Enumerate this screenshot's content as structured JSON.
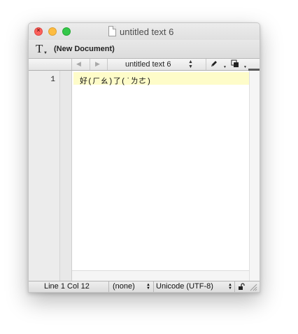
{
  "window": {
    "title": "untitled text 6",
    "icons": {
      "close": "close-button",
      "minimize": "minimize-button",
      "zoom": "zoom-button",
      "document": "document-icon"
    },
    "colors": {
      "close": "#fc605b",
      "minimize": "#fdbc40",
      "zoom": "#34c84a"
    }
  },
  "toolbar": {
    "text_icon": "T",
    "document_label": "(New Document)"
  },
  "navbar": {
    "back": "◀",
    "forward": "▶",
    "document_name": "untitled text 6",
    "updown": "▲\n▼",
    "icons": [
      "pen-icon",
      "copy-icon"
    ]
  },
  "editor": {
    "line_numbers": [
      "1"
    ],
    "lines": [
      "好(ㄏㄠ)了(˙ㄌㄜ)"
    ],
    "current_line_color": "#fefcc9"
  },
  "statusbar": {
    "position": "Line 1 Col 12",
    "syntax": "(none)",
    "encoding": "Unicode (UTF-8)",
    "icons": [
      "lock-icon",
      "resize-grip-icon"
    ]
  }
}
